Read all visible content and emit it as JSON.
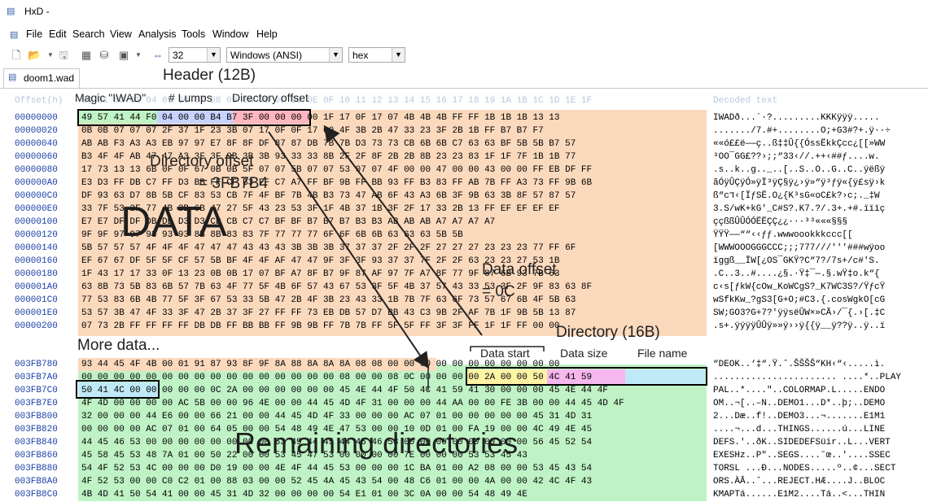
{
  "window": {
    "title": "HxD -",
    "icon": "hxd-app-icon"
  },
  "menu": [
    "File",
    "Edit",
    "Search",
    "View",
    "Analysis",
    "Tools",
    "Window",
    "Help"
  ],
  "toolbar": {
    "bytes_per_row": "32",
    "charset": "Windows (ANSI)",
    "offset_base": "hex",
    "icons": [
      "new-file-icon",
      "open-file-icon",
      "dropdown-icon",
      "save-icon",
      "stop-icon",
      "disk-icon",
      "ram-icon",
      "dropdown-icon",
      "bytes-per-row-icon"
    ]
  },
  "tab": {
    "label": "doom1.wad"
  },
  "hex": {
    "header_offset": "Offset(h)",
    "header_cols": "00 01 02 03 04 05 06 07 08 09 0A 0B 0C 0D 0E 0F 10 11 12 13 14 15 16 17 18 19 1A 1B 1C 1D 1E 1F",
    "header_decoded": "Decoded text",
    "top_rows": [
      {
        "offset": "00000000",
        "hex": "49 57 41 44 F0 04 00 00 B4 B7 3F 00 00 00 00 1F 17 0F 17 07 4B 4B 4B FF FF 1B 1B 1B 13 13",
        "ascii": "IWADð...´·?.........KKKÿÿÿ....."
      },
      {
        "offset": "00000020",
        "hex": "0B 0B 07 07 07 2F 37 1F 23 3B 07 17 0F 0F 17 00 4F 3B 2B 47 33 23 3F 2B 1B FF B7 B7 F7",
        "ascii": "......./7.#+........O;+G3#?+.ÿ··÷"
      },
      {
        "offset": "00000040",
        "hex": "AB AB F3 A3 A3 EB 97 97 E7 8F 8F DF 87 87 DB 7B 7B D3 73 73 CB 6B 6B C7 63 63 BF 5B 5B B7 57",
        "ascii": "««ó££ë——ç..ß‡‡Û{{ÓssËkkÇcc¿[[»WW"
      },
      {
        "offset": "00000060",
        "hex": "B3 4F 4F AB 47 47 A3 3F 3F 9B 3B 3B 93 33 33 8B 2F 2F 8F 2B 2B 8B 23 23 83 1F 1F 7F 1B 1B 77",
        "ascii": "³OO¯GG£??›;;“33‹//.++‹##ƒ....w."
      },
      {
        "offset": "00000080",
        "hex": "17 73 13 13 6B 0F 0F 67 0B 0B 5F 07 07 5B 07 07 53 07 07 4F 00 00 47 00 00 43 00 00 FF EB DF FF",
        "ascii": ".s..k..g.._..[..S..O..G..C..ÿëßÿ"
      },
      {
        "offset": "000000A0",
        "hex": "E3 D3 FF DB C7 FF D3 BB FF CF B3 FF C7 A7 FF BF 9B FF BB 93 FF B3 83 FF AB 7B FF A3 73 FF 9B 6B",
        "ascii": "ãÓÿÛÇÿÓ»ÿÏ³ÿÇ§ÿ¿›ÿ»“ÿ³ƒÿ«{ÿ£sÿ›k"
      },
      {
        "offset": "000000C0",
        "hex": "DF 93 63 D7 8B 5B CF 83 53 CB 7F 4F BF 7B 4B B3 73 47 AB 6F 43 A3 6B 3F 9B 63 3B 8F 57 87 57",
        "ascii": "ß“cד‹[ÏƒSË.O¿{K³sG«oC£k?›c;._‡W"
      },
      {
        "offset": "000000E0",
        "hex": "33 7F 53 2F 77 4B 2B 6B 47 27 5F 43 23 53 3F 1F 4B 37 1B 3F 2F 17 33 2B 13 FF EF EF EF EF",
        "ascii": "3.S/wK+kG'_C#S?.K7.?/.3+.+#.ïïïç"
      },
      {
        "offset": "00000100",
        "hex": "E7 E7 DF DF DB DB D3 D3 CB CB C7 C7 BF BF B7 B7 B7 B3 B3 AB AB AB A7 A7 A7 A7",
        "ascii": "ççßßÛÛÓÓËËÇÇ¿¿···³³«««§§§"
      },
      {
        "offset": "00000120",
        "hex": "9F 9F 97 97 93 93 93 8B 8B 83 83 7F 77 77 77 6F 6F 6B 6B 63 63 63 5B 5B",
        "ascii": "ŸŸŸ——““‹‹ƒƒ.wwwoookkkccc[["
      },
      {
        "offset": "00000140",
        "hex": "5B 57 57 57 4F 4F 4F 47 47 47 43 43 43 3B 3B 3B 37 37 37 2F 2F 2F 27 27 27 23 23 23 77 FF 6F",
        "ascii": "[WWWOOOGGGCCC;;;777///'''###wÿoo"
      },
      {
        "offset": "00000160",
        "hex": "EF 67 67 DF 5F 5F CF 57 5B BF 4F 4F AF 47 47 9F 3F 3F 93 37 37 7F 2F 2F 63 23 23 27 53 1B",
        "ascii": "ïggß__ÏW[¿OS¯GKŸ?C“7?/7s+/c#'S."
      },
      {
        "offset": "00000180",
        "hex": "1F 43 17 17 33 0F 13 23 0B 0B 17 07 BF A7 8F B7 9F 87 AF 97 7F A7 8F 77 9F 87 6B 93 7B 63",
        "ascii": ".C..3..#....¿§.·Ÿ‡¯—.§.wŸ‡o.k“{"
      },
      {
        "offset": "000001A0",
        "hex": "63 8B 73 5B 83 6B 57 7B 63 4F 77 5F 4B 6F 57 43 67 53 3F 5F 4B 37 57 43 33 53 3F 2F 9F 83 63 8F",
        "ascii": "c‹s[ƒkW{cOw_KoWCgS?_K7WC3S?/ŸƒcŸ"
      },
      {
        "offset": "000001C0",
        "hex": "77 53 83 6B 4B 77 5F 3F 67 53 33 5B 47 2B 4F 3B 23 43 33 1B 7B 7F 63 6F 73 57 67 6B 4F 5B 63",
        "ascii": "wSfkKw_?gS3[G+O;#C3.{.cosWgkO[cG"
      },
      {
        "offset": "000001E0",
        "hex": "53 57 3B 47 4F 33 3F 47 2B 37 3F 27 FF FF 73 EB DB 57 D7 BB 43 C3 9B 2F AF 7B 1F 9B 5B 13 87",
        "ascii": "SW;GO3?G+7?'ÿÿsëÛW×»CÃ›/¯{.›[.‡C"
      },
      {
        "offset": "00000200",
        "hex": "07 73 2B FF FF FF FF DB DB FF BB BB FF 9B 9B FF 7B 7B FF 5F 5F FF 3F 3F FF 1F 1F FF 00 00",
        "ascii": ".s+.ÿÿÿÿÛÛÿ»»ÿ››ÿ{{ÿ__ÿ??ÿ..ÿ..ï"
      }
    ],
    "bottom_rows": [
      {
        "offset": "003FB780",
        "hex": "93 44 45 4F 4B 00 01 91 87 93 8F 9F 8A 88 8A 8A 8A 08 08 00 00 00 00 00 00 00 00 00 00 00",
        "ascii": "“DEOK..‘‡“.Ÿ.ˆ.ŠŠŠŠ“KH‹“‹.....ì."
      },
      {
        "offset": "003FB7A0",
        "hex": "00 00 00 00 00 00 00 00 00 00 00 00 00 00 00 00 08 00 00 08 0C 00 00 00 00 2A 00 00 50 4C 41 59",
        "ascii": "....................... ....*..PLAY"
      },
      {
        "offset": "003FB7C0",
        "hex": "50 41 4C 00 00 00 00 00 0C 2A 00 00 00 00 00 00 45 4E 44 4F 50 4C 41 59 41 30 00 00 00 45 4E 44 4F",
        "ascii": "PAL..*....\"..COLORMAP.L.....ENDO"
      },
      {
        "offset": "003FB7E0",
        "hex": "4F 4D 00 00 00 00 AC 5B 00 00 96 4E 00 00 44 45 4D 4F 31 00 00 00 44 AA 00 00 FE 3B 00 00 44 45 4D 4F",
        "ascii": "OM..¬[..–N..DEMO1...D*..þ;..DEMO"
      },
      {
        "offset": "003FB800",
        "hex": "32 00 00 00 44 E6 00 00 66 21 00 00 44 45 4D 4F 33 00 00 00 AC 07 01 00 00 00 00 00 45 31 4D 31",
        "ascii": "2...Dæ..f!..DEMO3...¬.......E1M1"
      },
      {
        "offset": "003FB820",
        "hex": "00 00 00 00 AC 07 01 00 64 05 00 00 54 48 49 4E 47 53 00 00 10 0D 01 00 FA 19 00 00 4C 49 4E 45",
        "ascii": "....¬...d...THINGS......ú...LINE"
      },
      {
        "offset": "003FB840",
        "hex": "44 45 46 53 00 00 00 00 00 00 00 00 53 49 44 45 44 45 46 53 00 00 00 00 00 00 00 00 56 45 52 54",
        "ascii": "DEFS.'..ðK..SIDEDEFSüir..L...VERT"
      },
      {
        "offset": "003FB860",
        "hex": "45 58 45 53 48 7A 01 00 50 22 00 00 53 45 47 53 00 00 00 00 7E 00 00 00 53 53 45 43",
        "ascii": "EXESHz..P\"..SEGS....˜œ..'....SSEC"
      },
      {
        "offset": "003FB880",
        "hex": "54 4F 52 53 4C 00 00 00 D0 19 00 00 4E 4F 44 45 53 00 00 00 1C BA 01 00 A2 08 00 00 53 45 43 54",
        "ascii": "TORSL ...Ð...NODES.....º..¢...SECT"
      },
      {
        "offset": "003FB8A0",
        "hex": "4F 52 53 00 00 C0 C2 01 00 88 03 00 00 52 45 4A 45 43 54 00 48 C6 01 00 00 4A 00 00 42 4C 4F 43",
        "ascii": "ORS.ÀÂ..ˆ...REJECT.HÆ....J..BLOC"
      },
      {
        "offset": "003FB8C0",
        "hex": "4B 4D 41 50 54 41 00 00 45 31 4D 32 00 00 00 00 54 E1 01 00 3C 0A 00 00 54 48 49 4E",
        "ascii": "KMAPTá......E1M2....Tá..<...THIN"
      }
    ]
  },
  "annotations": {
    "header": "Header (12B)",
    "magic": "Magic \"IWAD\"",
    "lumps": "# Lumps",
    "dir_offset_label": "Directory offset",
    "dir_offset_note": "Directory offset",
    "dir_offset_value": "= 3FB7B4",
    "data": "DATA",
    "data_offset": "Data offset",
    "data_offset_value": "= 0C",
    "more_data": "More data...",
    "directory": "Directory (16B)",
    "data_start": "Data start",
    "data_size": "Data size",
    "file_name": "File name",
    "remaining": "Remaining directories"
  },
  "colors": {
    "data_bg": "#fbd9bd",
    "dir_bg": "#bff2c4",
    "magic_bg": "#bff2c4",
    "lumps_bg": "#c7d3ff",
    "diroffset_bg": "#ffb6c1",
    "start_bg": "#fff3a6",
    "size_bg": "#f6b7ef",
    "name_bg": "#bfe9f7"
  }
}
